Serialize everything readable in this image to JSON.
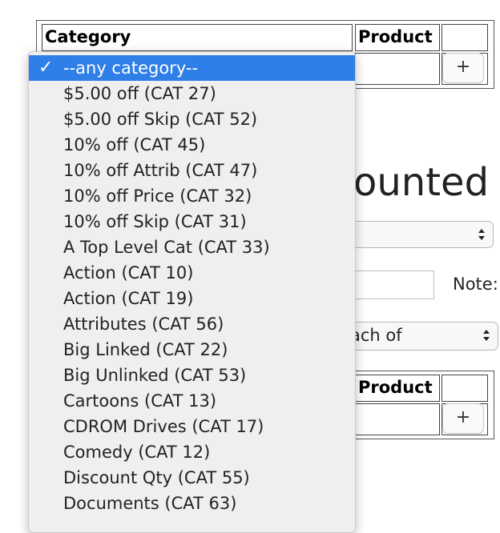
{
  "top_table": {
    "category_header": "Category",
    "product_header": "Product",
    "add_button": "+"
  },
  "heading_fragment": "ounted",
  "select1": {
    "value": ""
  },
  "note_label": "Note:",
  "select2": {
    "value": "ach of"
  },
  "bottom_table": {
    "product_header": "Product",
    "add_button": "+"
  },
  "icons": {
    "updown": "updown-arrows-icon",
    "check": "checkmark-icon"
  },
  "dropdown": {
    "selected_check": "✓",
    "options": [
      "--any category--",
      "$5.00 off (CAT 27)",
      "$5.00 off Skip (CAT 52)",
      "10% off (CAT 45)",
      "10% off Attrib (CAT 47)",
      "10% off Price (CAT 32)",
      "10% off Skip (CAT 31)",
      "A Top Level Cat (CAT 33)",
      "Action (CAT 10)",
      "Action (CAT 19)",
      "Attributes (CAT 56)",
      "Big Linked (CAT 22)",
      "Big Unlinked (CAT 53)",
      "Cartoons (CAT 13)",
      "CDROM Drives (CAT 17)",
      "Comedy (CAT 12)",
      "Discount Qty (CAT 55)",
      "Documents (CAT 63)"
    ]
  },
  "colors": {
    "selection": "#2f7fe8",
    "menu_bg": "#efefef"
  }
}
